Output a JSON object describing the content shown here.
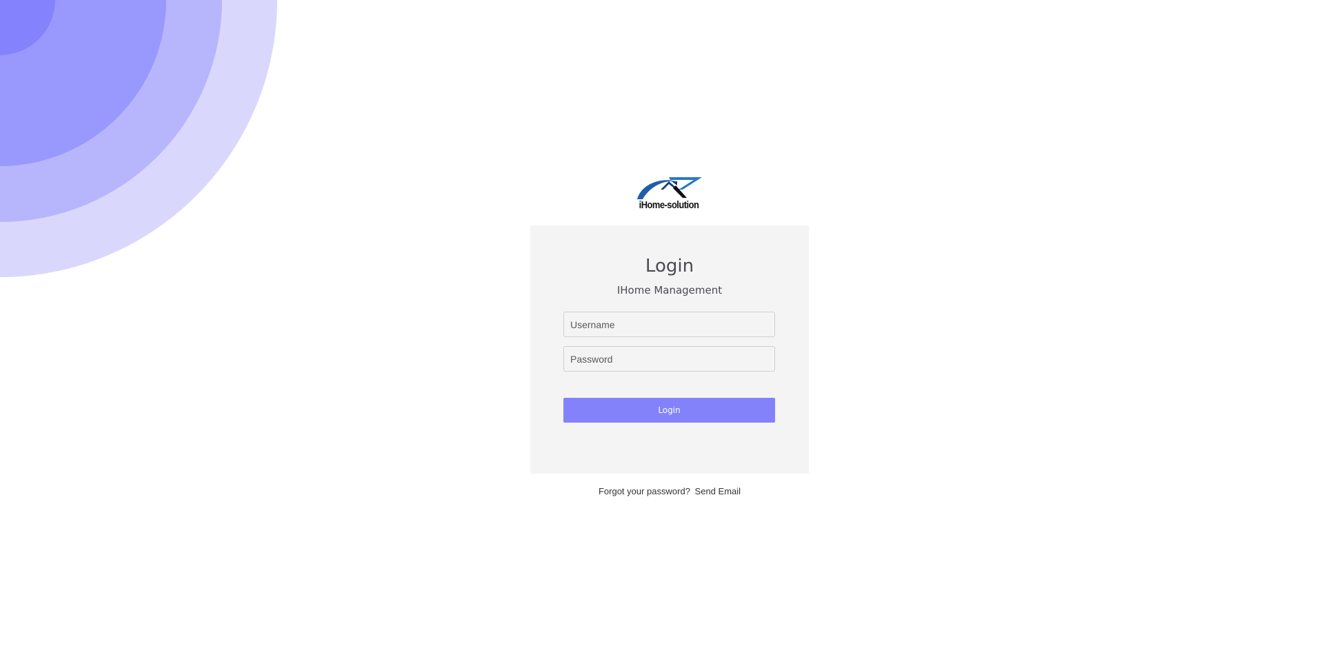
{
  "brand": {
    "logo_text": "iHome-solution",
    "accent_color": "#8482fb",
    "logo_blue": "#1f5fa8"
  },
  "login_card": {
    "title": "Login",
    "subtitle": "IHome Management",
    "username_placeholder": "Username",
    "password_placeholder": "Password",
    "submit_label": "Login"
  },
  "footer": {
    "forgot_text": "Forgot your password?",
    "send_email_link": "Send Email"
  },
  "decoration": {
    "ring_colors": [
      "#8482fd",
      "#9998fd",
      "#b7b6fc",
      "#d9d8fc"
    ]
  }
}
